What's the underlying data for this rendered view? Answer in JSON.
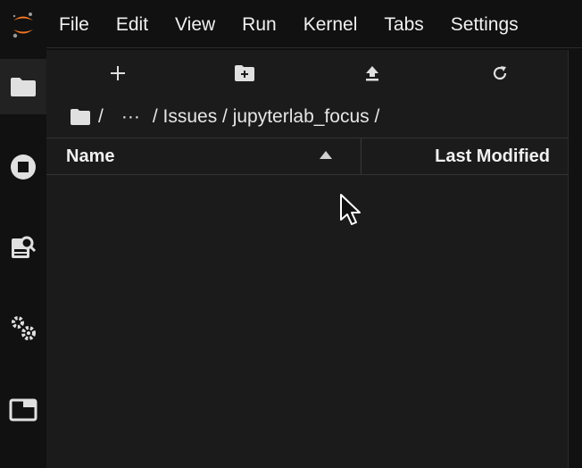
{
  "menu": {
    "items": [
      "File",
      "Edit",
      "View",
      "Run",
      "Kernel",
      "Tabs",
      "Settings"
    ]
  },
  "icons": {
    "logo": "jupyter-logo-icon",
    "activity": [
      "folder-icon",
      "stop-circle-icon",
      "property-inspector-icon",
      "extensions-gear-icon",
      "tab-window-icon"
    ],
    "toolbar": [
      "new-launcher-icon",
      "new-folder-icon",
      "upload-icon",
      "refresh-icon"
    ]
  },
  "breadcrumbs": {
    "sep1": "/",
    "ellipsis": "···",
    "path": "/ Issues / jupyterlab_focus /"
  },
  "listing": {
    "name_header": "Name",
    "modified_header": "Last Modified"
  },
  "colors": {
    "background": "#111111",
    "panel": "#1b1b1b",
    "logo_orange": "#f37726",
    "text": "#e6e6e6"
  }
}
